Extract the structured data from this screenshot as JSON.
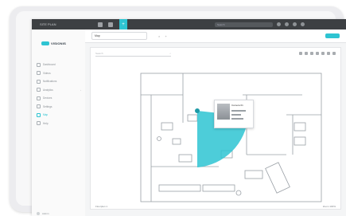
{
  "app": {
    "title": "SITE PLAN",
    "search_placeholder": "Search"
  },
  "sidebar": {
    "logo": "VISIONIS",
    "items": [
      {
        "label": "Dashboard",
        "icon": "grid-icon"
      },
      {
        "label": "Videos",
        "icon": "video-icon"
      },
      {
        "label": "Notifications",
        "icon": "bell-icon"
      },
      {
        "label": "Analytics",
        "icon": "chart-icon",
        "caret": "›"
      },
      {
        "label": "Devices",
        "icon": "camera-icon"
      },
      {
        "label": "Settings",
        "icon": "gear-icon"
      },
      {
        "label": "Map",
        "icon": "map-icon",
        "active": true
      },
      {
        "label": "Help",
        "icon": "help-icon"
      }
    ],
    "footer_label": "Admin"
  },
  "tabs": [
    {
      "label": "Map"
    }
  ],
  "canvas": {
    "search_placeholder": "Search",
    "search_icon": "search-icon",
    "status_left": "Floorplan 1",
    "status_right": "Zoom 100%"
  },
  "popup": {
    "name": "Camera 01"
  },
  "colors": {
    "accent": "#2ec4d2",
    "topbar": "#3d4043"
  }
}
